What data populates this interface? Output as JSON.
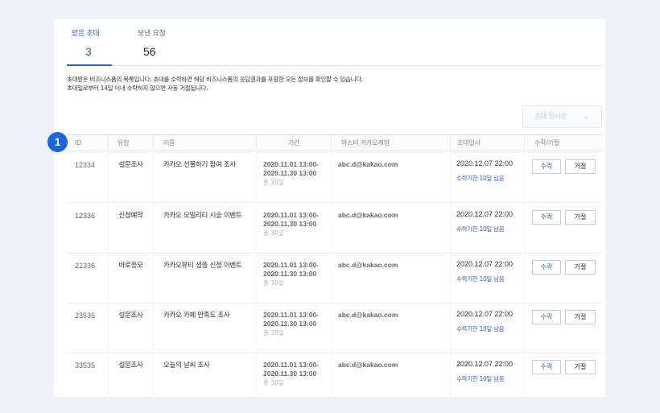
{
  "tabs": [
    {
      "label": "받은 초대",
      "count": "3"
    },
    {
      "label": "보낸 요청",
      "count": "56"
    }
  ],
  "description": {
    "line1": "초대받은 비즈니스폼의 목록입니다. 초대를 수락하면 해당 비즈니스폼의 응답결과를 포함한 모든 정보를 확인할 수 있습니다.",
    "line2": "초대일로부터 14일 이내 수락하지 않으면 자동 거절됩니다."
  },
  "sort": {
    "label": "초대 일시순",
    "icon": "chevron-down-icon"
  },
  "table": {
    "headers": [
      "ID",
      "유형",
      "이름",
      "기간",
      "마스터 카카오계정",
      "초대일시",
      "수락/거절"
    ],
    "rows": [
      {
        "id": "12334",
        "type": "설문조사",
        "name": "카카오 선물하기 참여 조사",
        "period1": "2020.11.01 13:00-",
        "period2": "2020.11.30 13:00",
        "period3": "총 30일",
        "email": "abc.d@kakao.com",
        "date": "2020.12.07 22:00",
        "deadline": "수락기한 10일 남음",
        "accept": "수락",
        "reject": "거절"
      },
      {
        "id": "12336",
        "type": "신청예약",
        "name": "카카오 모빌리티 시승 이벤트",
        "period1": "2020.11.01 13:00-",
        "period2": "2020.11.30 13:00",
        "period3": "총 30일",
        "email": "abc.d@kakao.com",
        "date": "2020.12.07 22:00",
        "deadline": "수락기한 10일 남음",
        "accept": "수락",
        "reject": "거절"
      },
      {
        "id": "22336",
        "type": "바로응모",
        "name": "카카오뷰티 샘플 신청 이벤트",
        "period1": "2020.11.01 13:00-",
        "period2": "2020.11.30 13:00",
        "period3": "총 30일",
        "email": "abc.d@kakao.com",
        "date": "2020.12.07 22:00",
        "deadline": "수락기한 10일 남음",
        "accept": "수락",
        "reject": "거절"
      },
      {
        "id": "23535",
        "type": "설문조사",
        "name": "카카오 카페 만족도 조사",
        "period1": "2020.11.01 13:00-",
        "period2": "2020.11.30 13:00",
        "period3": "총 30일",
        "email": "abc.d@kakao.com",
        "date": "2020.12.07 22:00",
        "deadline": "수락기한 10일 남음",
        "accept": "수락",
        "reject": "거절"
      },
      {
        "id": "33535",
        "type": "설문조사",
        "name": "오늘의 날씨 조사",
        "period1": "2020.11.01 13:00-",
        "period2": "2020.11.30 13:00",
        "period3": "총 30일",
        "email": "abc.d@kakao.com",
        "date": "2020.12.07 22:00",
        "deadline": "수락기한 10일 남음",
        "accept": "수락",
        "reject": "거절"
      }
    ]
  },
  "marker": {
    "number": "1",
    "color": "#1c64e0"
  },
  "colors": {
    "accent": "#2b5fc9"
  }
}
